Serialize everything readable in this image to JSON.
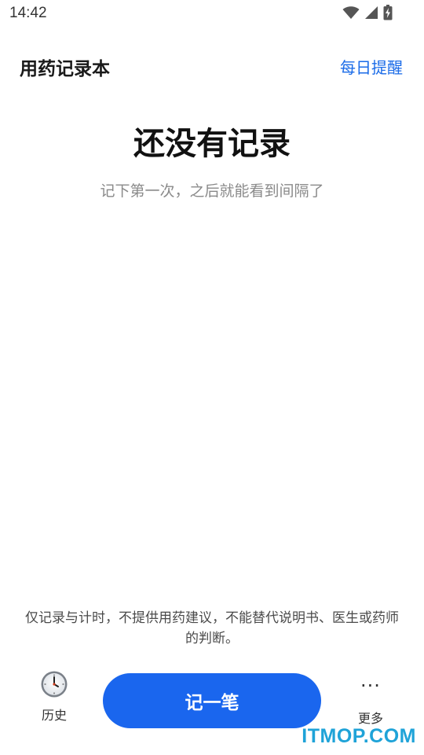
{
  "status_bar": {
    "time": "14:42",
    "icons": [
      "wifi-icon",
      "cellular-signal-icon",
      "battery-charging-icon"
    ]
  },
  "header": {
    "title": "用药记录本",
    "reminder_label": "每日提醒",
    "accent_color": "#1a6be8"
  },
  "empty_state": {
    "title": "还没有记录",
    "subtitle": "记下第一次，之后就能看到间隔了"
  },
  "disclaimer": "仅记录与计时，不提供用药建议，不能替代说明书、医生或药师的判断。",
  "bottom_bar": {
    "history": {
      "icon": "clock-icon",
      "label": "历史"
    },
    "primary_button": {
      "label": "记一笔",
      "color": "#1a66ee"
    },
    "more": {
      "icon": "more-dots-icon",
      "glyph": "···",
      "label": "更多"
    }
  },
  "watermark": "ITMOP.COM"
}
